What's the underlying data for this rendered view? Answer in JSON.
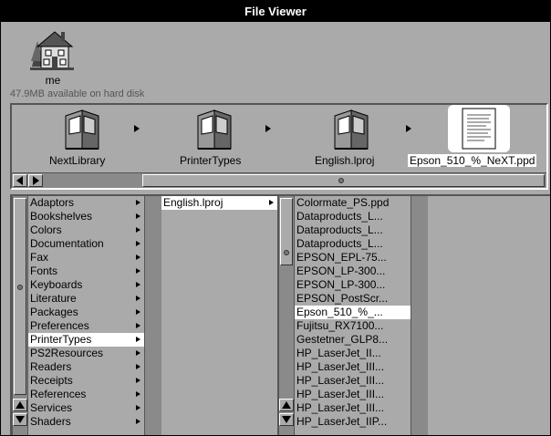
{
  "window": {
    "title": "File Viewer"
  },
  "home": {
    "label": "me",
    "disk_info": "47.9MB available on hard disk"
  },
  "shelf": {
    "items": [
      {
        "label": "NextLibrary",
        "type": "folder"
      },
      {
        "label": "PrinterTypes",
        "type": "folder"
      },
      {
        "label": "English.lproj",
        "type": "folder"
      },
      {
        "label": "Epson_510_%_NeXT.ppd",
        "type": "document",
        "selected": true
      }
    ]
  },
  "columns": {
    "col1": {
      "items": [
        {
          "label": "Adaptors",
          "branch": true
        },
        {
          "label": "Bookshelves",
          "branch": true
        },
        {
          "label": "Colors",
          "branch": true
        },
        {
          "label": "Documentation",
          "branch": true
        },
        {
          "label": "Fax",
          "branch": true
        },
        {
          "label": "Fonts",
          "branch": true
        },
        {
          "label": "Keyboards",
          "branch": true
        },
        {
          "label": "Literature",
          "branch": true
        },
        {
          "label": "Packages",
          "branch": true
        },
        {
          "label": "Preferences",
          "branch": true
        },
        {
          "label": "PrinterTypes",
          "branch": true,
          "selected": true
        },
        {
          "label": "PS2Resources",
          "branch": true
        },
        {
          "label": "Readers",
          "branch": true
        },
        {
          "label": "Receipts",
          "branch": true
        },
        {
          "label": "References",
          "branch": true
        },
        {
          "label": "Services",
          "branch": true
        },
        {
          "label": "Shaders",
          "branch": true
        }
      ]
    },
    "col2": {
      "items": [
        {
          "label": "English.lproj",
          "branch": true,
          "selected": true
        }
      ]
    },
    "col3": {
      "items": [
        {
          "label": "Colormate_PS.ppd"
        },
        {
          "label": "Dataproducts_L..."
        },
        {
          "label": "Dataproducts_L..."
        },
        {
          "label": "Dataproducts_L..."
        },
        {
          "label": "EPSON_EPL-75..."
        },
        {
          "label": "EPSON_LP-300..."
        },
        {
          "label": "EPSON_LP-300..."
        },
        {
          "label": "EPSON_PostScr..."
        },
        {
          "label": "Epson_510_%_...",
          "selected": true
        },
        {
          "label": "Fujitsu_RX7100..."
        },
        {
          "label": "Gestetner_GLP8..."
        },
        {
          "label": "HP_LaserJet_II..."
        },
        {
          "label": "HP_LaserJet_III..."
        },
        {
          "label": "HP_LaserJet_III..."
        },
        {
          "label": "HP_LaserJet_III..."
        },
        {
          "label": "HP_LaserJet_III..."
        },
        {
          "label": "HP_LaserJet_IIP..."
        }
      ]
    }
  },
  "colors": {
    "titlebar": "#000000",
    "background": "#aaaaaa",
    "selection": "#ffffff"
  }
}
